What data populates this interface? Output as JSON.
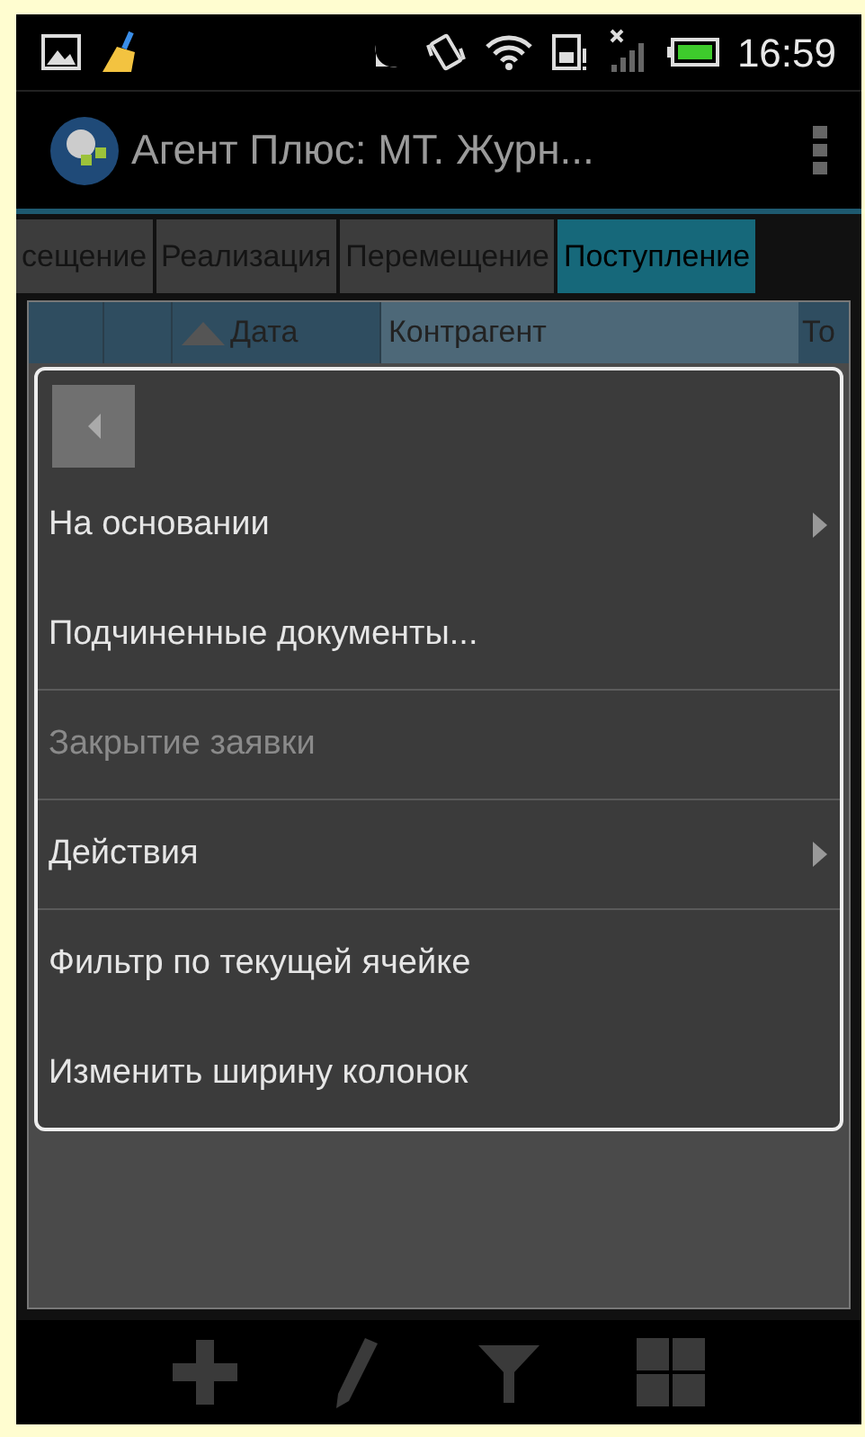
{
  "status_bar": {
    "time": "16:59"
  },
  "app_bar": {
    "title": "Агент Плюс: МТ. Журн..."
  },
  "tabs": [
    {
      "label": "сещение",
      "selected": false
    },
    {
      "label": "Реализация",
      "selected": false
    },
    {
      "label": "Перемещение",
      "selected": false
    },
    {
      "label": "Поступление",
      "selected": true
    }
  ],
  "table": {
    "columns": [
      "Дата",
      "Контрагент",
      "То"
    ]
  },
  "menu": {
    "items": [
      {
        "label": "На основании",
        "kind": "submenu",
        "disabled": false,
        "divider": false
      },
      {
        "label": "Подчиненные документы...",
        "kind": "plain",
        "disabled": false,
        "divider": false
      },
      {
        "label": "Закрытие заявки",
        "kind": "plain",
        "disabled": true,
        "divider": true
      },
      {
        "label": "Действия",
        "kind": "submenu",
        "disabled": false,
        "divider": true
      },
      {
        "label": "Фильтр по текущей ячейке",
        "kind": "plain",
        "disabled": false,
        "divider": true
      },
      {
        "label": "Изменить ширину колонок",
        "kind": "plain",
        "disabled": false,
        "divider": false
      }
    ]
  }
}
